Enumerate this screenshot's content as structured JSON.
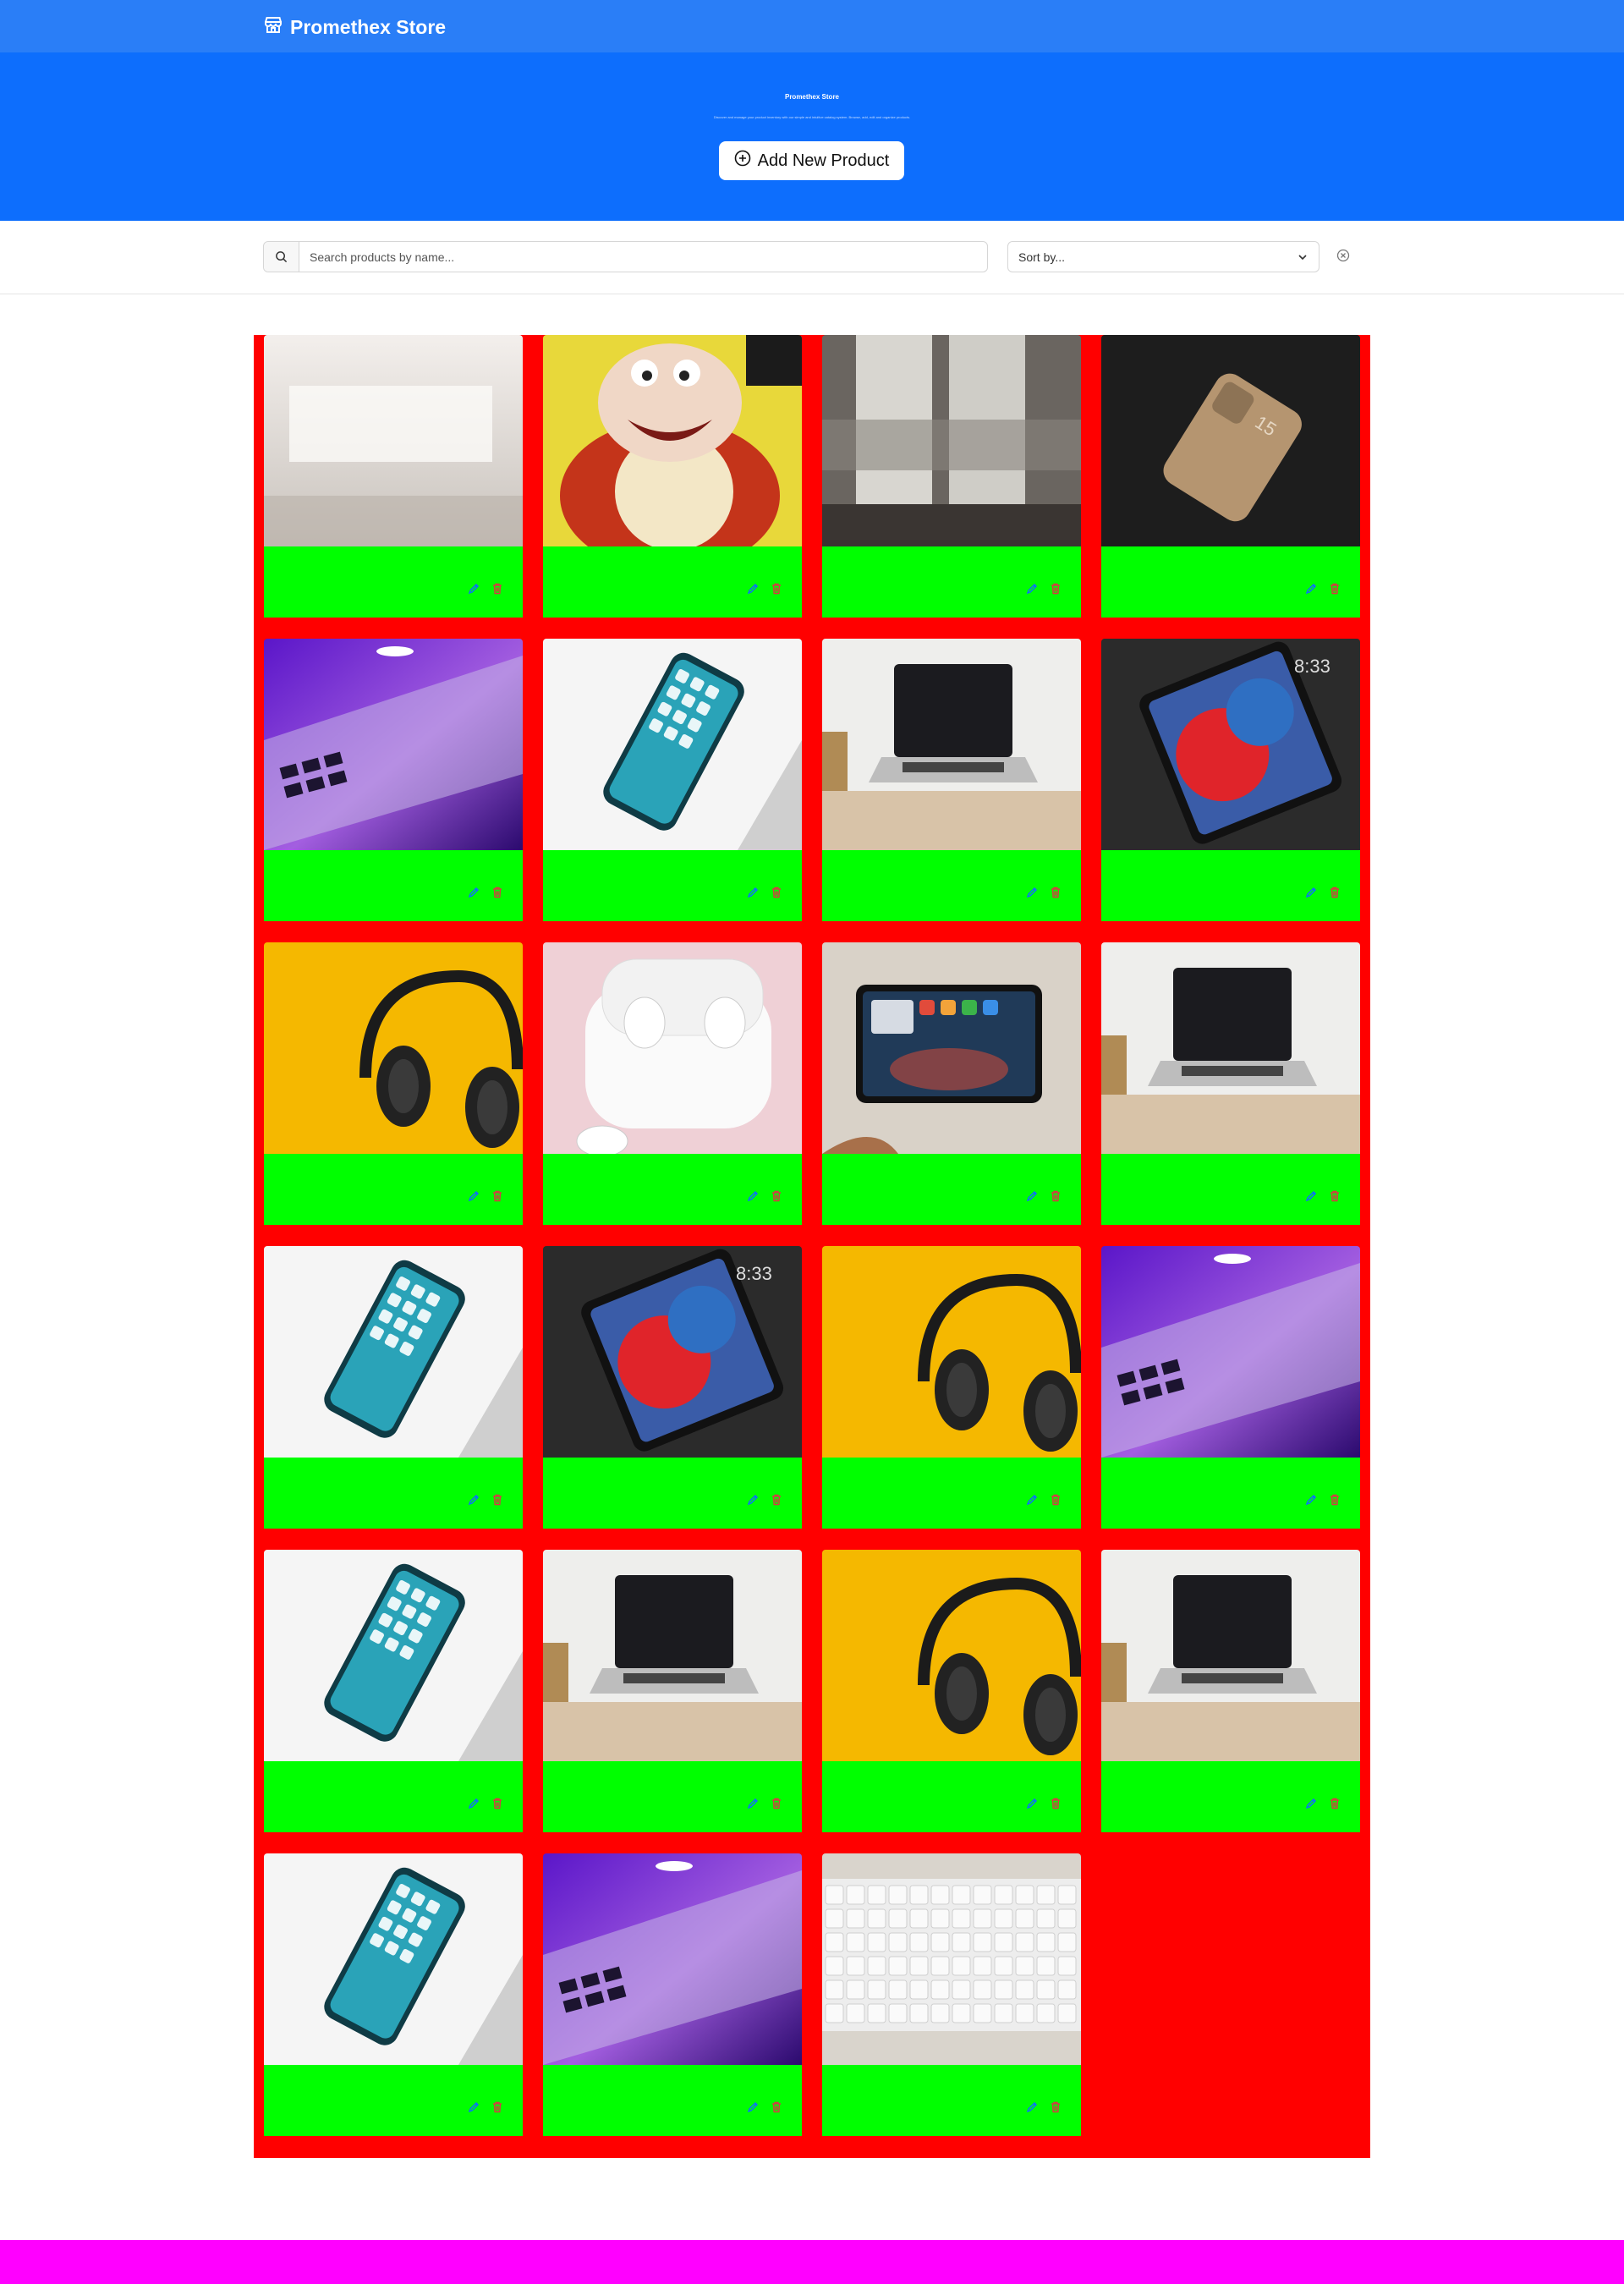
{
  "navbar": {
    "brand": "Promethex Store",
    "brand_icon": "store-icon",
    "color": "#2a7ef7"
  },
  "hero": {
    "title": "Promethex Store",
    "subtitle": "Discover and manage your product inventory with our simple and intuitive catalog system. Browse, add, edit and organize products.",
    "add_button_label": "Add New Product",
    "color": "#0d6efd"
  },
  "filters": {
    "search_placeholder": "Search products by name...",
    "search_value": "",
    "sort_label": "Sort by...",
    "clear_icon": "close-circle-icon"
  },
  "products": [
    {
      "image": "blurred-room-photo"
    },
    {
      "image": "cartoon-bird-photo"
    },
    {
      "image": "blurred-window-photo"
    },
    {
      "image": "gold-phone-photo"
    },
    {
      "image": "laptop-purple-photo"
    },
    {
      "image": "iphone-photo"
    },
    {
      "image": "macbook-desk-photo"
    },
    {
      "image": "ipad-photo"
    },
    {
      "image": "headphones-yellow-photo"
    },
    {
      "image": "airpods-photo"
    },
    {
      "image": "ipad-hand-photo"
    },
    {
      "image": "macbook-desk-photo"
    },
    {
      "image": "iphone-photo"
    },
    {
      "image": "ipad-photo"
    },
    {
      "image": "headphones-yellow-photo"
    },
    {
      "image": "laptop-purple-photo"
    },
    {
      "image": "iphone-photo"
    },
    {
      "image": "macbook-desk-photo"
    },
    {
      "image": "headphones-yellow-photo"
    },
    {
      "image": "macbook-desk-photo"
    },
    {
      "image": "iphone-photo"
    },
    {
      "image": "laptop-purple-photo"
    },
    {
      "image": "keyboard-photo"
    }
  ],
  "colors": {
    "grid_bg": "#ff0000",
    "card_body": "#00ff00",
    "footer": "#ff00ff",
    "edit_icon": "#0d6efd",
    "delete_icon": "#dc3545"
  }
}
